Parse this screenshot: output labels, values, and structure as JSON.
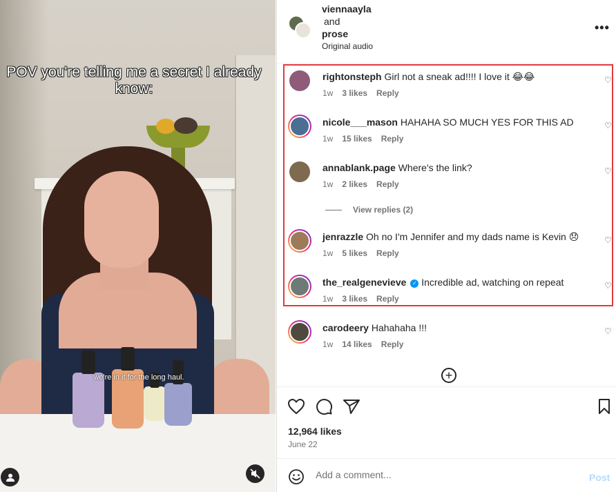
{
  "video": {
    "overlay_text": "POV you're telling me a secret I already know:",
    "caption": "we're in it for the long haul."
  },
  "header": {
    "user1": "viennaayla",
    "and": "and",
    "user2": "prose",
    "audio": "Original audio"
  },
  "comments": [
    {
      "user": "rightonsteph",
      "text": "Girl not a sneak ad!!!! I love it 😂😂",
      "time": "1w",
      "likes": "3 likes",
      "reply": "Reply",
      "verified": false,
      "avatar_color": "#8e5b7a"
    },
    {
      "user": "nicole___mason",
      "text": "HAHAHA SO MUCH YES FOR THIS AD",
      "time": "1w",
      "likes": "15 likes",
      "reply": "Reply",
      "verified": false,
      "avatar_color": "#4a6f93"
    },
    {
      "user": "annablank.page",
      "text": "Where's the link?",
      "time": "1w",
      "likes": "2 likes",
      "reply": "Reply",
      "verified": false,
      "avatar_color": "#7e6a4e"
    },
    {
      "user": "jenrazzle",
      "text": "Oh no I'm Jennifer and my dads name is Kevin 😞",
      "time": "1w",
      "likes": "5 likes",
      "reply": "Reply",
      "verified": false,
      "avatar_color": "#9d7a5a"
    },
    {
      "user": "the_realgenevieve",
      "text": "Incredible ad, watching on repeat",
      "time": "1w",
      "likes": "3 likes",
      "reply": "Reply",
      "verified": true,
      "avatar_color": "#6d7a75"
    },
    {
      "user": "carodeery",
      "text": "Hahahaha !!!",
      "time": "1w",
      "likes": "14 likes",
      "reply": "Reply",
      "verified": false,
      "avatar_color": "#4f4a3d"
    }
  ],
  "view_replies": "View replies (2)",
  "footer": {
    "likes": "12,964 likes",
    "date": "June 22",
    "comment_placeholder": "Add a comment...",
    "post_label": "Post"
  },
  "colors": {
    "highlight": "#e0393e",
    "verified": "#0095f6",
    "post_disabled": "#b3dbff"
  }
}
